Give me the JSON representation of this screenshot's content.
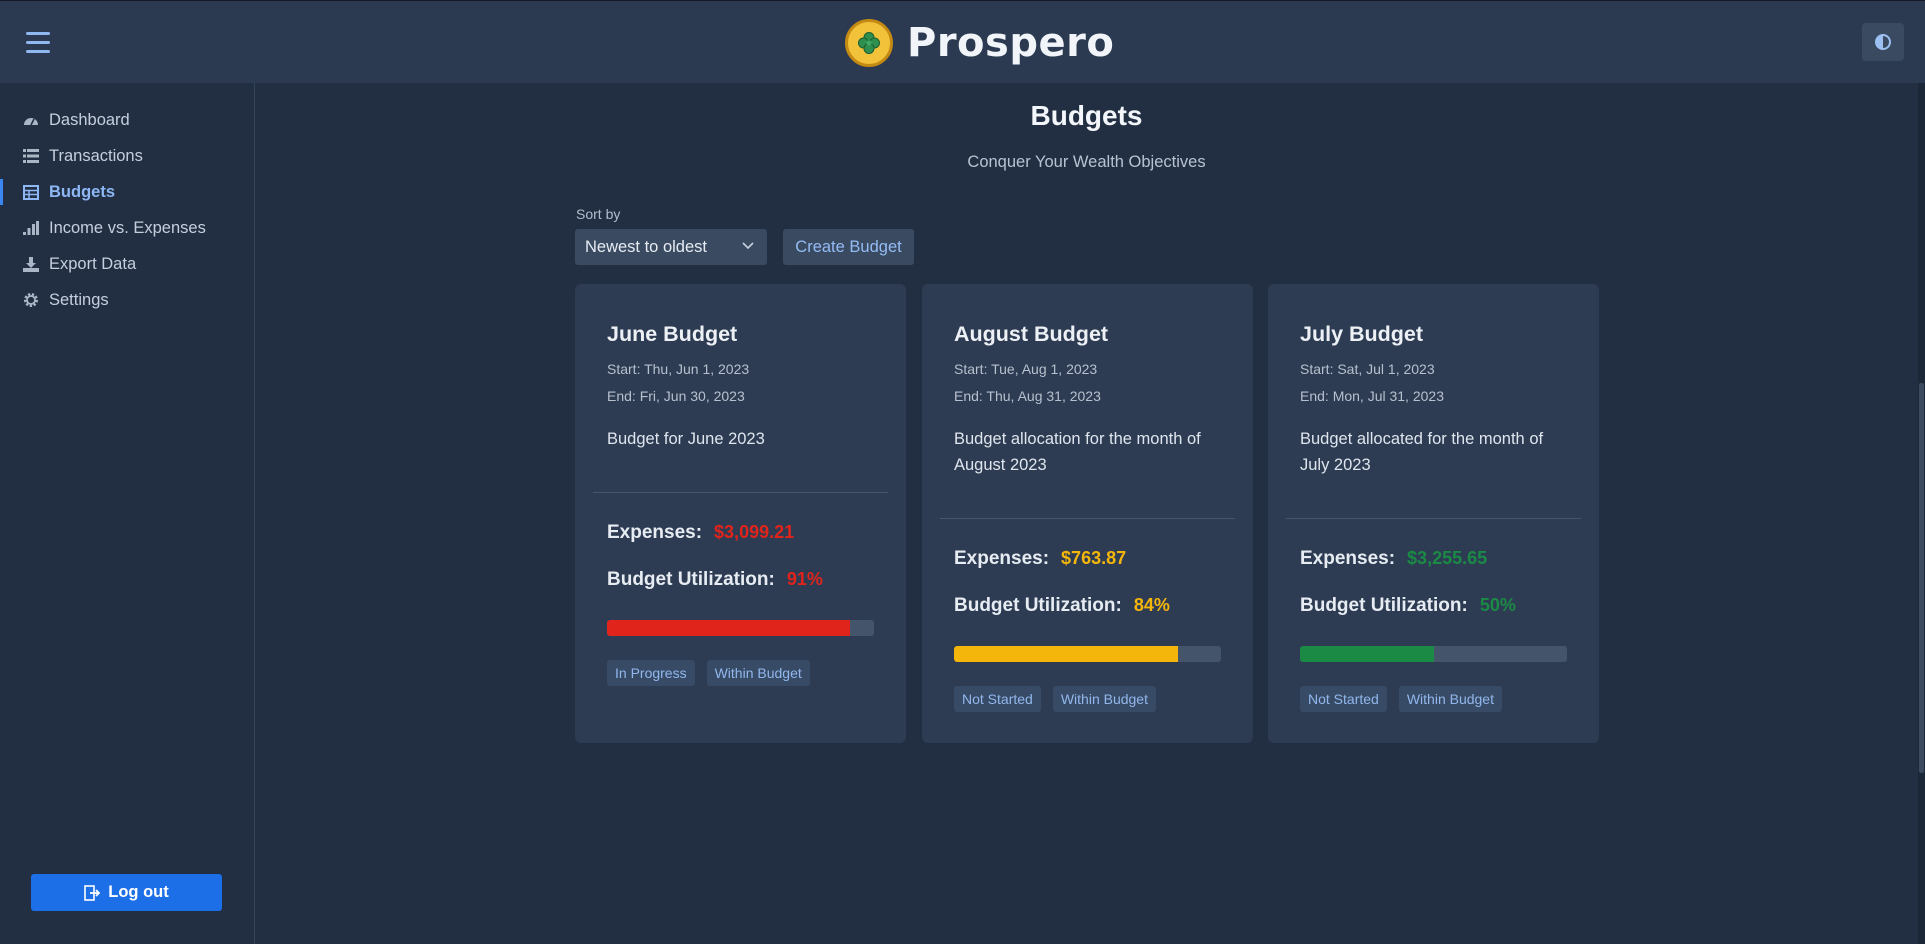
{
  "app": {
    "name": "Prospero"
  },
  "sidebar": {
    "items": [
      {
        "label": "Dashboard",
        "icon": "gauge-icon"
      },
      {
        "label": "Transactions",
        "icon": "list-icon"
      },
      {
        "label": "Budgets",
        "icon": "budget-table-icon",
        "active": true
      },
      {
        "label": "Income vs. Expenses",
        "icon": "bar-chart-icon"
      },
      {
        "label": "Export Data",
        "icon": "download-icon"
      },
      {
        "label": "Settings",
        "icon": "gear-icon"
      }
    ],
    "logout_label": "Log out"
  },
  "main": {
    "title": "Budgets",
    "subtitle": "Conquer Your Wealth Objectives",
    "sort_label": "Sort by",
    "sort_value": "Newest to oldest",
    "create_label": "Create Budget"
  },
  "labels": {
    "expenses": "Expenses:",
    "utilization": "Budget Utilization:"
  },
  "budgets": [
    {
      "title": "June Budget",
      "start": "Start: Thu, Jun 1, 2023",
      "end": "End: Fri, Jun 30, 2023",
      "description": "Budget for June 2023",
      "expenses": "$3,099.21",
      "utilization": "91%",
      "utilization_fraction": 0.91,
      "status": "In Progress",
      "budget_state": "Within Budget",
      "color": "#e0241b"
    },
    {
      "title": "August Budget",
      "start": "Start: Tue, Aug 1, 2023",
      "end": "End: Thu, Aug 31, 2023",
      "description": "Budget allocation for the month of August 2023",
      "expenses": "$763.87",
      "utilization": "84%",
      "utilization_fraction": 0.84,
      "status": "Not Started",
      "budget_state": "Within Budget",
      "color": "#f5b60b"
    },
    {
      "title": "July Budget",
      "start": "Start: Sat, Jul 1, 2023",
      "end": "End: Mon, Jul 31, 2023",
      "description": "Budget allocated for the month of July 2023",
      "expenses": "$3,255.65",
      "utilization": "50%",
      "utilization_fraction": 0.5,
      "status": "Not Started",
      "budget_state": "Within Budget",
      "color": "#1a8a45"
    }
  ]
}
